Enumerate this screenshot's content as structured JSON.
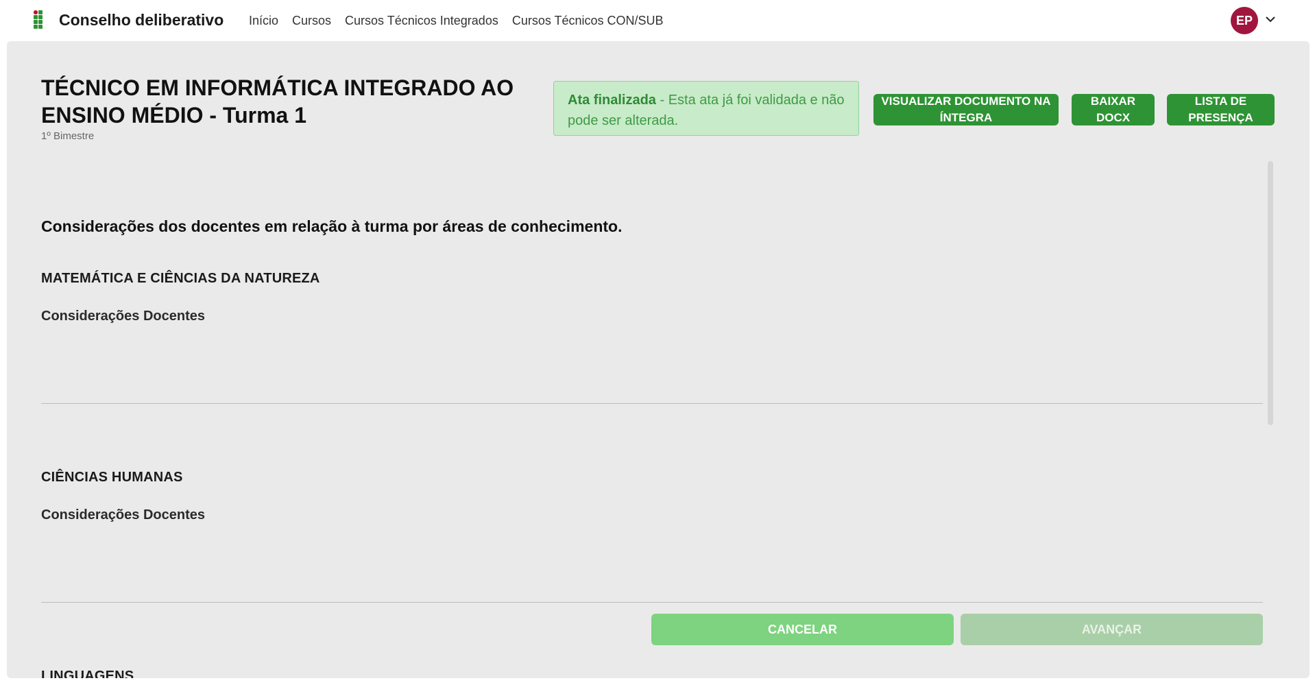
{
  "header": {
    "app_title": "Conselho deliberativo",
    "nav": [
      {
        "label": "Início"
      },
      {
        "label": "Cursos"
      },
      {
        "label": "Cursos Técnicos Integrados"
      },
      {
        "label": "Cursos Técnicos CON/SUB"
      }
    ],
    "user_initials": "EP",
    "colors": {
      "logo_green": "#2e9334",
      "logo_red": "#c8102e",
      "avatar_bg": "#a1163e"
    }
  },
  "page": {
    "course_title": "TÉCNICO EM INFORMÁTICA INTEGRADO AO ENSINO MÉDIO - Turma 1",
    "period": "1º Bimestre",
    "alert": {
      "strong": "Ata finalizada",
      "text": " - Esta ata já foi validada e não pode ser alterada."
    },
    "actions": {
      "view_full": "VISUALIZAR DOCUMENTO NA ÍNTEGRA",
      "download_docx": "BAIXAR DOCX",
      "attendance_list": "LISTA DE PRESENÇA"
    },
    "section_heading": "Considerações dos docentes em relação à turma por áreas de conhecimento.",
    "areas": [
      {
        "title": "MATEMÁTICA E CIÊNCIAS DA NATUREZA",
        "subtitle": "Considerações Docentes"
      },
      {
        "title": "CIÊNCIAS HUMANAS",
        "subtitle": "Considerações Docentes"
      },
      {
        "title": "LINGUAGENS"
      }
    ],
    "footer": {
      "cancel": "CANCELAR",
      "next": "AVANÇAR"
    },
    "colors": {
      "primary_green": "#2e9334",
      "alert_bg": "#c8ebc9",
      "card_bg": "#ebeaea"
    }
  }
}
